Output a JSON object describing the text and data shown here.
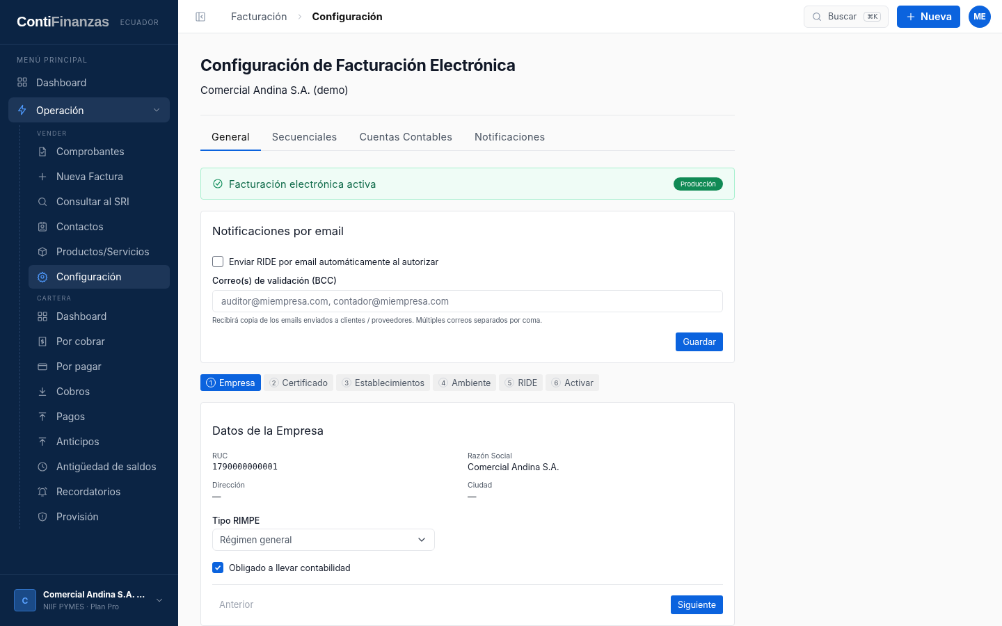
{
  "brand": {
    "name_first": "Conti",
    "name_second": "Finanzas",
    "region": "ECUADOR"
  },
  "sidebar": {
    "section_label": "MENÚ PRINCIPAL",
    "items": [
      {
        "label": "Dashboard",
        "selected": false
      },
      {
        "label": "Operación",
        "selected": true,
        "expanded": true,
        "groups": [
          {
            "label": "VENDER",
            "items": [
              {
                "label": "Comprobantes",
                "selected": false
              },
              {
                "label": "Nueva Factura",
                "selected": false
              },
              {
                "label": "Consultar al SRI",
                "selected": false
              },
              {
                "label": "Contactos",
                "selected": false
              },
              {
                "label": "Productos/Servicios",
                "selected": false
              },
              {
                "label": "Configuración",
                "selected": true
              }
            ]
          },
          {
            "label": "CARTERA",
            "items": [
              {
                "label": "Dashboard",
                "selected": false
              },
              {
                "label": "Por cobrar",
                "selected": false
              },
              {
                "label": "Por pagar",
                "selected": false
              },
              {
                "label": "Cobros",
                "selected": false
              },
              {
                "label": "Pagos",
                "selected": false
              },
              {
                "label": "Anticipos",
                "selected": false
              },
              {
                "label": "Antigüedad de saldos",
                "selected": false
              },
              {
                "label": "Recordatorios",
                "selected": false
              },
              {
                "label": "Provisión",
                "selected": false
              }
            ]
          }
        ]
      }
    ]
  },
  "company_switcher": {
    "avatar": "C",
    "name": "Comercial Andina S.A. ...",
    "subtitle": "NIIF PYMES · Plan Pro"
  },
  "topbar": {
    "breadcrumb": [
      "Facturación",
      "Configuración"
    ],
    "search": {
      "placeholder": "Buscar",
      "shortcut": "⌘K"
    },
    "new_button": "Nueva",
    "user_avatar": "ME"
  },
  "page": {
    "title": "Configuración de Facturación Electrónica",
    "subtitle": "Comercial Andina S.A. (demo)",
    "tabs": [
      {
        "label": "General",
        "selected": true
      },
      {
        "label": "Secuenciales",
        "selected": false
      },
      {
        "label": "Cuentas Contables",
        "selected": false
      },
      {
        "label": "Notificaciones",
        "selected": false
      }
    ],
    "status_banner": {
      "text": "Facturación electrónica activa",
      "badge": "Producción"
    },
    "email_card": {
      "title": "Notificaciones por email",
      "checkbox": {
        "label": "Enviar RIDE por email automáticamente al autorizar",
        "checked": false
      },
      "field_label": "Correo(s) de validación (BCC)",
      "field_placeholder": "auditor@miempresa.com, contador@miempresa.com",
      "hint": "Recibirá copia de los emails enviados a clientes / proveedores. Múltiples correos separados por coma.",
      "button": "Guardar"
    },
    "steps": [
      {
        "number": "1",
        "label": "Empresa",
        "selected": true
      },
      {
        "number": "2",
        "label": "Certificado",
        "selected": false
      },
      {
        "number": "3",
        "label": "Establecimientos",
        "selected": false
      },
      {
        "number": "4",
        "label": "Ambiente",
        "selected": false
      },
      {
        "number": "5",
        "label": "RIDE",
        "selected": false
      },
      {
        "number": "6",
        "label": "Activar",
        "selected": false
      }
    ],
    "company_card": {
      "title": "Datos de la Empresa",
      "fields": [
        {
          "label": "RUC",
          "value": "1790000000001",
          "kind": "mono"
        },
        {
          "label": "Razón Social",
          "value": "Comercial Andina S.A.",
          "kind": "text"
        },
        {
          "label": "Dirección",
          "value": "—",
          "kind": "text"
        },
        {
          "label": "Ciudad",
          "value": "—",
          "kind": "text"
        }
      ],
      "rimpe_label": "Tipo RIMPE",
      "rimpe_value": "Régimen general",
      "checkbox": {
        "label": "Obligado a llevar contabilidad",
        "checked": true
      },
      "prev_button": {
        "label": "Anterior",
        "disabled": true
      },
      "next_button": {
        "label": "Siguiente",
        "disabled": false
      }
    }
  }
}
